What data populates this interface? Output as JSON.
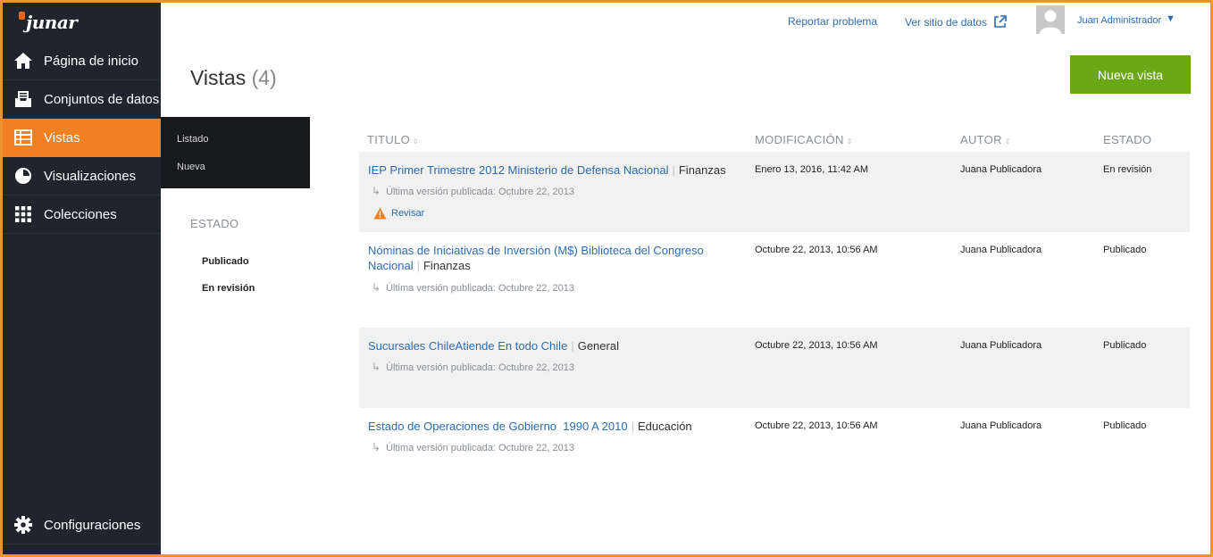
{
  "app": {
    "logo_text": "junar"
  },
  "sidebar": {
    "items": [
      {
        "label": "Página de inicio",
        "icon": "home-icon"
      },
      {
        "label": "Conjuntos de datos",
        "icon": "inbox-icon"
      },
      {
        "label": "Vistas",
        "icon": "table-icon",
        "active": true
      },
      {
        "label": "Visualizaciones",
        "icon": "pie-chart-icon"
      },
      {
        "label": "Colecciones",
        "icon": "grid-icon"
      }
    ],
    "bottom": {
      "label": "Configuraciones",
      "icon": "gear-icon"
    }
  },
  "submenu": {
    "listado": "Listado",
    "nueva": "Nueva"
  },
  "filters": {
    "title": "ESTADO",
    "items": [
      "Publicado",
      "En revisión"
    ]
  },
  "header": {
    "report_link": "Reportar problema",
    "site_link": "Ver sitio de datos",
    "user_name": "Juan Administrador",
    "caret": "▼"
  },
  "page": {
    "title": "Vistas",
    "count": "(4)",
    "new_button": "Nueva vista"
  },
  "table": {
    "headers": {
      "title": "TITULO",
      "modified": "MODIFICACIÓN",
      "author": "AUTOR",
      "status": "ESTADO"
    },
    "rows": [
      {
        "title": "IEP Primer Trimestre 2012 Ministerio de Defensa Nacional",
        "category": "Finanzas",
        "last_published": "Última versión publicada: Octubre 22, 2013",
        "modified": "Enero 13, 2016, 11:42 AM",
        "author": "Juana Publicadora",
        "status": "En revisión",
        "action": "Revisar"
      },
      {
        "title": "Nóminas de Iniciativas de Inversión (M$) Biblioteca del Congreso Nacional",
        "category": "Finanzas",
        "last_published": "Última versión publicada: Octubre 22, 2013",
        "modified": "Octubre 22, 2013, 10:56 AM",
        "author": "Juana Publicadora",
        "status": "Publicado"
      },
      {
        "title": "Sucursales ChileAtiende En todo Chile",
        "category": "General",
        "last_published": "Última versión publicada: Octubre 22, 2013",
        "modified": "Octubre 22, 2013, 10:56 AM",
        "author": "Juana Publicadora",
        "status": "Publicado"
      },
      {
        "title": "Estado de Operaciones de Gobierno  1990 A 2010",
        "category": "Educación",
        "last_published": "Última versión publicada: Octubre 22, 2013",
        "modified": "Octubre 22, 2013, 10:56 AM",
        "author": "Juana Publicadora",
        "status": "Publicado"
      }
    ]
  },
  "colors": {
    "accent": "#f08020",
    "sidebar": "#21252b",
    "link": "#2b6cb0",
    "button": "#6aa915"
  }
}
